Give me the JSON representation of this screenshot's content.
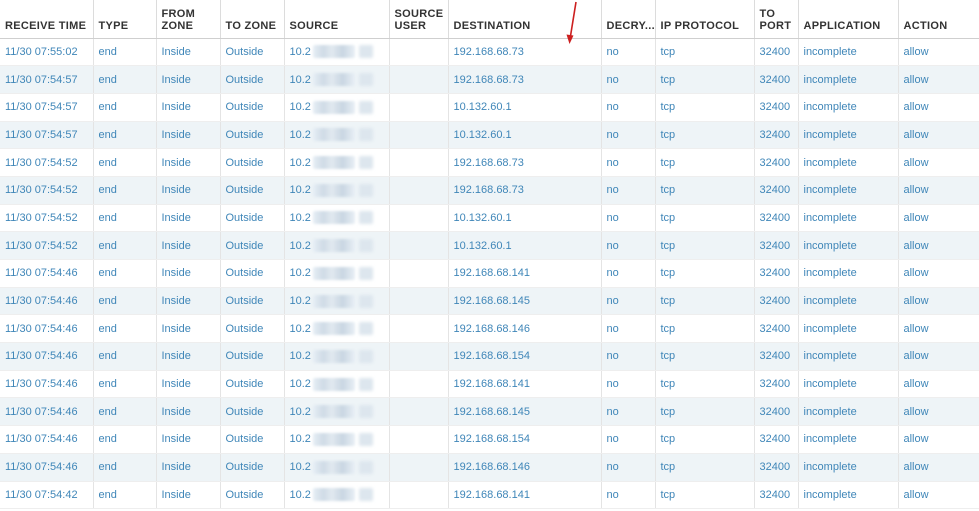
{
  "columns": [
    "RECEIVE TIME",
    "TYPE",
    "FROM ZONE",
    "TO ZONE",
    "SOURCE",
    "SOURCE USER",
    "DESTINATION",
    "DECRY...",
    "IP PROTOCOL",
    "TO PORT",
    "APPLICATION",
    "ACTION"
  ],
  "source_prefix": "10.2",
  "rows": [
    {
      "time": "11/30 07:55:02",
      "type": "end",
      "from_zone": "Inside",
      "to_zone": "Outside",
      "destination": "192.168.68.73",
      "decrypted": "no",
      "protocol": "tcp",
      "port": "32400",
      "application": "incomplete",
      "action": "allow"
    },
    {
      "time": "11/30 07:54:57",
      "type": "end",
      "from_zone": "Inside",
      "to_zone": "Outside",
      "destination": "192.168.68.73",
      "decrypted": "no",
      "protocol": "tcp",
      "port": "32400",
      "application": "incomplete",
      "action": "allow"
    },
    {
      "time": "11/30 07:54:57",
      "type": "end",
      "from_zone": "Inside",
      "to_zone": "Outside",
      "destination": "10.132.60.1",
      "decrypted": "no",
      "protocol": "tcp",
      "port": "32400",
      "application": "incomplete",
      "action": "allow"
    },
    {
      "time": "11/30 07:54:57",
      "type": "end",
      "from_zone": "Inside",
      "to_zone": "Outside",
      "destination": "10.132.60.1",
      "decrypted": "no",
      "protocol": "tcp",
      "port": "32400",
      "application": "incomplete",
      "action": "allow"
    },
    {
      "time": "11/30 07:54:52",
      "type": "end",
      "from_zone": "Inside",
      "to_zone": "Outside",
      "destination": "192.168.68.73",
      "decrypted": "no",
      "protocol": "tcp",
      "port": "32400",
      "application": "incomplete",
      "action": "allow"
    },
    {
      "time": "11/30 07:54:52",
      "type": "end",
      "from_zone": "Inside",
      "to_zone": "Outside",
      "destination": "192.168.68.73",
      "decrypted": "no",
      "protocol": "tcp",
      "port": "32400",
      "application": "incomplete",
      "action": "allow"
    },
    {
      "time": "11/30 07:54:52",
      "type": "end",
      "from_zone": "Inside",
      "to_zone": "Outside",
      "destination": "10.132.60.1",
      "decrypted": "no",
      "protocol": "tcp",
      "port": "32400",
      "application": "incomplete",
      "action": "allow"
    },
    {
      "time": "11/30 07:54:52",
      "type": "end",
      "from_zone": "Inside",
      "to_zone": "Outside",
      "destination": "10.132.60.1",
      "decrypted": "no",
      "protocol": "tcp",
      "port": "32400",
      "application": "incomplete",
      "action": "allow"
    },
    {
      "time": "11/30 07:54:46",
      "type": "end",
      "from_zone": "Inside",
      "to_zone": "Outside",
      "destination": "192.168.68.141",
      "decrypted": "no",
      "protocol": "tcp",
      "port": "32400",
      "application": "incomplete",
      "action": "allow"
    },
    {
      "time": "11/30 07:54:46",
      "type": "end",
      "from_zone": "Inside",
      "to_zone": "Outside",
      "destination": "192.168.68.145",
      "decrypted": "no",
      "protocol": "tcp",
      "port": "32400",
      "application": "incomplete",
      "action": "allow"
    },
    {
      "time": "11/30 07:54:46",
      "type": "end",
      "from_zone": "Inside",
      "to_zone": "Outside",
      "destination": "192.168.68.146",
      "decrypted": "no",
      "protocol": "tcp",
      "port": "32400",
      "application": "incomplete",
      "action": "allow"
    },
    {
      "time": "11/30 07:54:46",
      "type": "end",
      "from_zone": "Inside",
      "to_zone": "Outside",
      "destination": "192.168.68.154",
      "decrypted": "no",
      "protocol": "tcp",
      "port": "32400",
      "application": "incomplete",
      "action": "allow"
    },
    {
      "time": "11/30 07:54:46",
      "type": "end",
      "from_zone": "Inside",
      "to_zone": "Outside",
      "destination": "192.168.68.141",
      "decrypted": "no",
      "protocol": "tcp",
      "port": "32400",
      "application": "incomplete",
      "action": "allow"
    },
    {
      "time": "11/30 07:54:46",
      "type": "end",
      "from_zone": "Inside",
      "to_zone": "Outside",
      "destination": "192.168.68.145",
      "decrypted": "no",
      "protocol": "tcp",
      "port": "32400",
      "application": "incomplete",
      "action": "allow"
    },
    {
      "time": "11/30 07:54:46",
      "type": "end",
      "from_zone": "Inside",
      "to_zone": "Outside",
      "destination": "192.168.68.154",
      "decrypted": "no",
      "protocol": "tcp",
      "port": "32400",
      "application": "incomplete",
      "action": "allow"
    },
    {
      "time": "11/30 07:54:46",
      "type": "end",
      "from_zone": "Inside",
      "to_zone": "Outside",
      "destination": "192.168.68.146",
      "decrypted": "no",
      "protocol": "tcp",
      "port": "32400",
      "application": "incomplete",
      "action": "allow"
    },
    {
      "time": "11/30 07:54:42",
      "type": "end",
      "from_zone": "Inside",
      "to_zone": "Outside",
      "destination": "192.168.68.141",
      "decrypted": "no",
      "protocol": "tcp",
      "port": "32400",
      "application": "incomplete",
      "action": "allow"
    }
  ],
  "colors": {
    "link": "#3f86b8",
    "header_text": "#333333",
    "row_alt": "#eef4f7",
    "annotation_arrow": "#cc1f1f"
  }
}
